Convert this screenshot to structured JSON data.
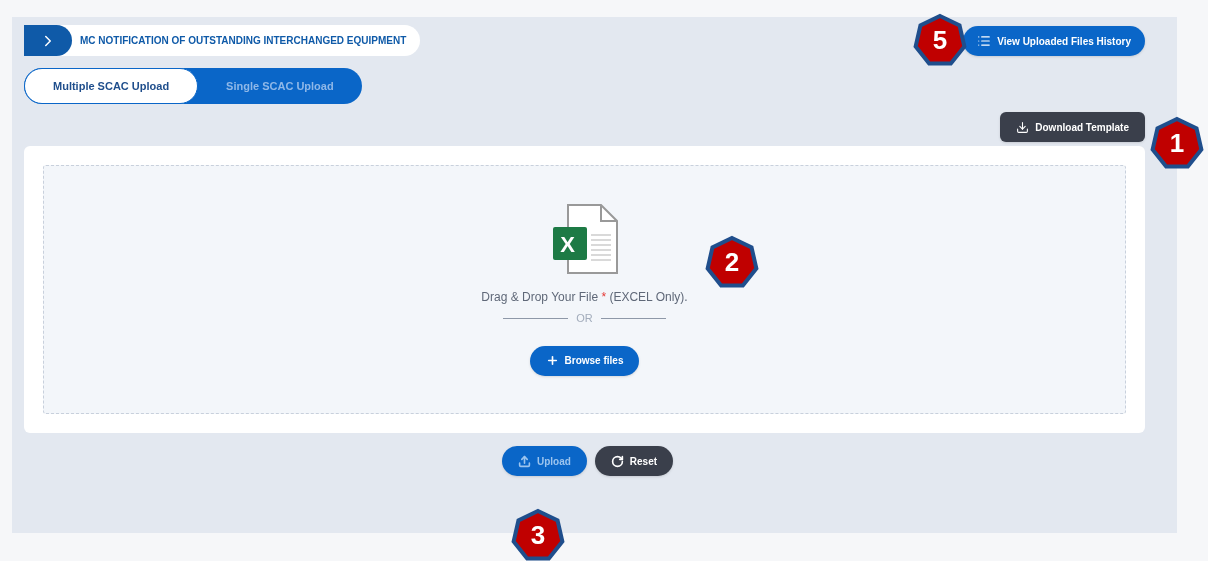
{
  "breadcrumb": {
    "title": "MC NOTIFICATION OF OUTSTANDING INTERCHANGED EQUIPMENT"
  },
  "tabs": [
    {
      "label": "Multiple SCAC Upload",
      "selected": true
    },
    {
      "label": "Single SCAC Upload",
      "selected": false
    }
  ],
  "history_button": "View Uploaded Files History",
  "template_button": "Download Template",
  "dropzone": {
    "icon_letter": "X",
    "prompt": "Drag & Drop Your File",
    "required_mark": "*",
    "hint": "(EXCEL Only).",
    "separator": "OR",
    "browse_button": "Browse files"
  },
  "actions": [
    {
      "kind": "upload",
      "label": "Upload",
      "disabled": true
    },
    {
      "kind": "reset",
      "label": "Reset",
      "disabled": false
    }
  ],
  "callouts": [
    {
      "number": "5"
    },
    {
      "number": "1"
    },
    {
      "number": "2"
    },
    {
      "number": "3"
    }
  ]
}
